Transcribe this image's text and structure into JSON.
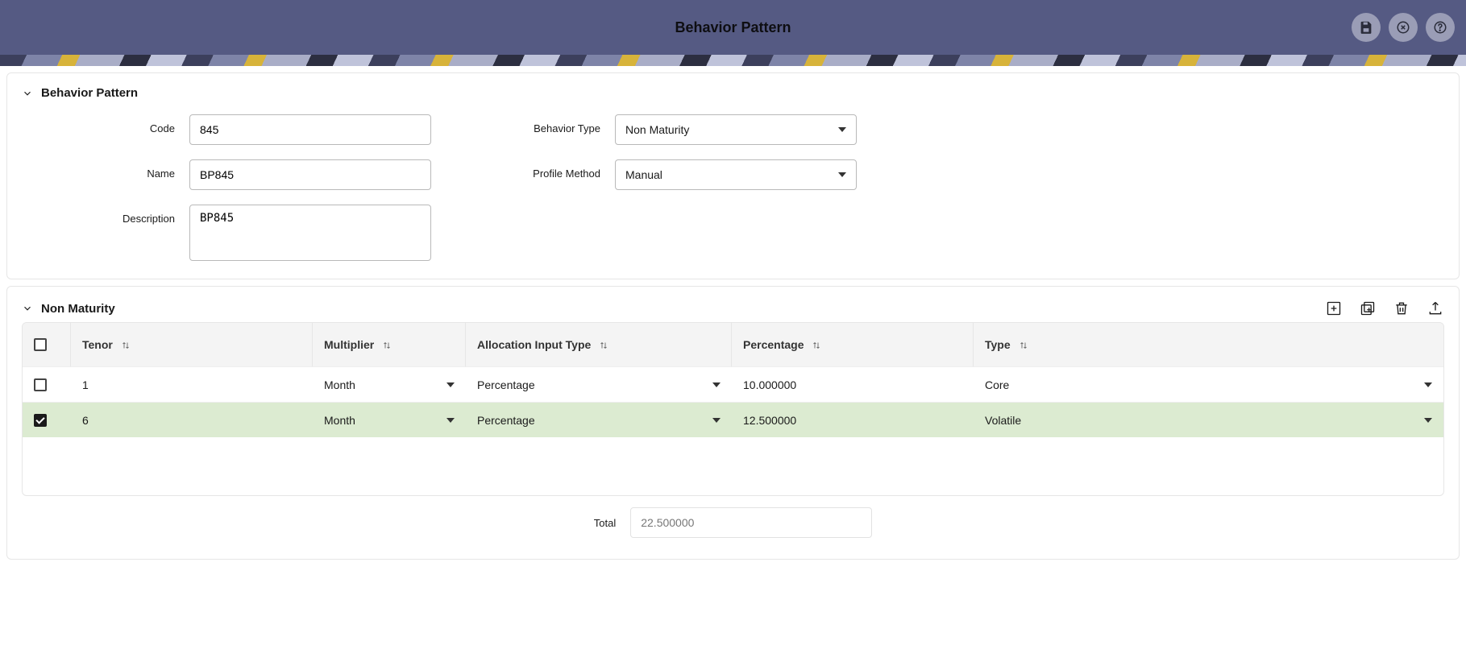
{
  "header": {
    "title": "Behavior Pattern",
    "icons": {
      "save": "save-icon",
      "cancel": "cancel-icon",
      "help": "help-icon"
    }
  },
  "panel_form": {
    "title": "Behavior Pattern",
    "labels": {
      "code": "Code",
      "name": "Name",
      "description": "Description",
      "behavior_type": "Behavior Type",
      "profile_method": "Profile Method"
    },
    "values": {
      "code": "845",
      "name": "BP845",
      "description": "BP845",
      "behavior_type": "Non Maturity",
      "profile_method": "Manual"
    }
  },
  "panel_grid": {
    "title": "Non Maturity",
    "columns": {
      "tenor": "Tenor",
      "multiplier": "Multiplier",
      "allocation": "Allocation Input Type",
      "percentage": "Percentage",
      "type": "Type"
    },
    "rows": [
      {
        "checked": false,
        "tenor": "1",
        "multiplier": "Month",
        "allocation": "Percentage",
        "percentage": "10.000000",
        "type": "Core"
      },
      {
        "checked": true,
        "tenor": "6",
        "multiplier": "Month",
        "allocation": "Percentage",
        "percentage": "12.500000",
        "type": "Volatile"
      }
    ],
    "total_label": "Total",
    "total_value": "22.500000"
  }
}
